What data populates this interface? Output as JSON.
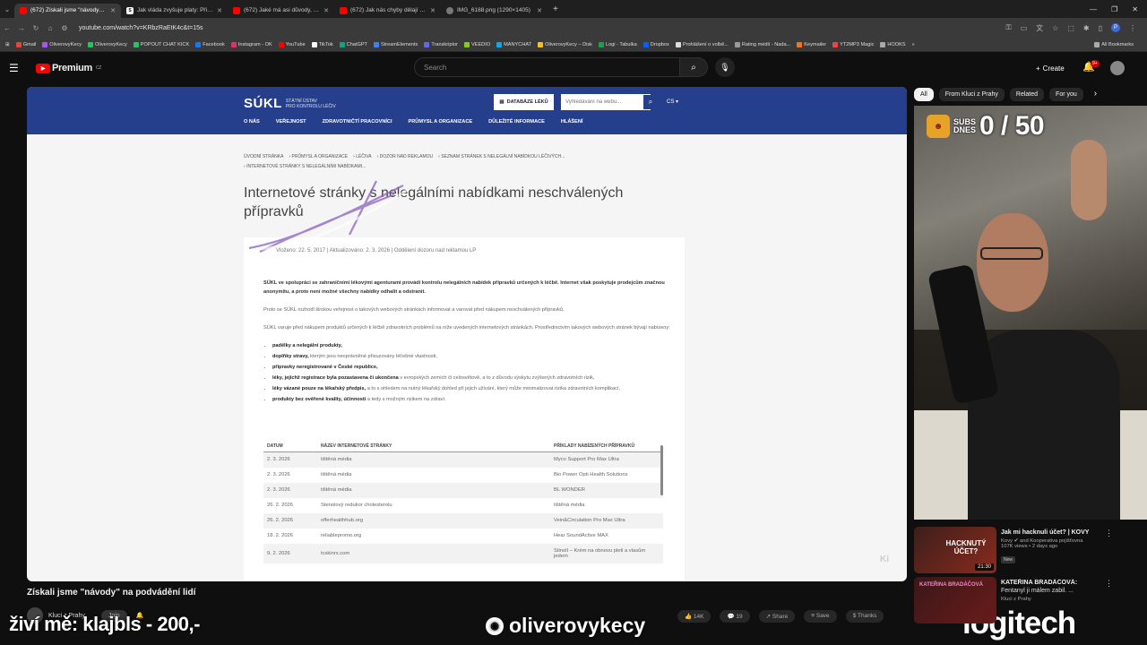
{
  "browser": {
    "tabs": [
      {
        "title": "(672) Získali jsme \"návody\" na pod",
        "active": true,
        "favicon": "youtube"
      },
      {
        "title": "Jak vláda zvyšuje platy: Přidá lé",
        "active": false,
        "favicon": "szu"
      },
      {
        "title": "(672) Jaké má asi důvody, proč",
        "active": false,
        "favicon": "youtube"
      },
      {
        "title": "(672) Jak nás chyby dělají chyt",
        "active": false,
        "favicon": "youtube"
      },
      {
        "title": "IMG_6188.png (1290×1405)",
        "active": false,
        "favicon": "image"
      }
    ],
    "url": "youtube.com/watch?v=KRbzRaEtK4c&t=15s",
    "bookmarks": [
      "Gmail",
      "OliverovyKecy",
      "OliverovyKecy",
      "POPOUT CHAT KICK",
      "Facebook",
      "Instagram - OK",
      "YouTube",
      "TikTok",
      "ChatGPT",
      "StreamElements",
      "Transkriptor",
      "VEEDIO",
      "MANYCHAT",
      "OliverovyKecy – Disk",
      "Logi - Tabulka",
      "Dropbox",
      "Prohlášení o volbě...",
      "Rating médií - Nada...",
      "Keymailer",
      "YT2MP3 Magic",
      "HOOKS"
    ],
    "all_bookmarks": "All Bookmarks",
    "profile_initial": "P"
  },
  "youtube": {
    "logo_text": "Premium",
    "region": "CZ",
    "search_placeholder": "Search",
    "create_label": "Create",
    "notif_count": "9+",
    "video_title": "Získali jsme \"návody\" na podvádění lidí",
    "channel_name": "Kluci z Prahy",
    "join_label": "Join",
    "actions": {
      "likes": "14K",
      "comments": "19",
      "share": "Share",
      "save": "Save",
      "thanks": "Thanks"
    },
    "chips": [
      "All",
      "From Kluci z Prahy",
      "Related",
      "For you"
    ],
    "recommendations": [
      {
        "title": "Jak mi hacknuli účet? | KOVY",
        "channel": "Kovy",
        "channel_extra": "and Kooperativa pojišťovna",
        "views": "107K views • 2 days ago",
        "badge": "New",
        "duration": "21:30",
        "thumb_text": "HACKNUTÝ ÚČET?"
      },
      {
        "title": "KATEŘINA BRADÁČOVÁ:",
        "subtitle": "Fentanyl ji málem zabil. ...",
        "channel": "Kluci z Prahy",
        "thumb_text": "KATEŘINA BRADÁČOVÁ"
      }
    ]
  },
  "sukl": {
    "logo": "SÚKL",
    "logo_sub1": "STÁTNÍ ÚSTAV",
    "logo_sub2": "PRO KONTROLU LÉČIV",
    "db_button": "DATABÁZE LÉKŮ",
    "search_placeholder": "Vyhledávání na webu...",
    "lang": "CS",
    "nav": [
      "O NÁS",
      "VEŘEJNOST",
      "ZDRAVOTNIČTÍ PRACOVNÍCI",
      "PRŮMYSL A ORGANIZACE",
      "DŮLEŽITÉ INFORMACE",
      "HLÁŠENÍ"
    ],
    "breadcrumb": [
      "ÚVODNÍ STRÁNKA",
      "PRŮMYSL A ORGANIZACE",
      "LÉČIVA",
      "DOZOR NAD REKLAMOU",
      "SEZNAM STRÁNEK S NELEGÁLNÍ NABÍDKOU LÉČIVÝCH...",
      "INTERNETOVÉ STRÁNKY S NELEGÁLNÍMI NABÍDKAMI..."
    ],
    "page_title": "Internetové stránky s nelegálními nabídkami neschválených přípravků",
    "meta": "Vloženo: 22. 5. 2017 | Aktualizováno: 2. 3. 2026 | Oddělení dozoru nad reklamou LP",
    "para1": "SÚKL ve spolupráci se zahraničními lékovými agenturami provádí kontrolu nelegálních nabídek přípravků určených k léčbě. Internet však poskytuje prodejcům značnou anonymitu, a proto není možné všechny nabídky odhalit a odstranit.",
    "para2": "Proto se SÚKL rozhodl širokou veřejnost o takových webových stránkách informovat a varovat před nákupem neschválených přípravků.",
    "para3": "SÚKL varuje před nákupem produktů určených k léčbě zdravotních problémů na níže uvedených internetových stránkách. Prostřednictvím takových webových stránek bývají nabízeny:",
    "list": [
      {
        "bold": "padělky a nelegální produkty,",
        "rest": ""
      },
      {
        "bold": "doplňky stravy,",
        "rest": " kterým jsou neoprávněné přisuzovány léčebné vlastnosti,"
      },
      {
        "bold": "přípravky neregistrované v České republice,",
        "rest": ""
      },
      {
        "bold": "léky, jejichž registrace byla pozastavena či ukončena",
        "rest": " v evropských zemích či celosvětově, a to z důvodu výskytu zvýšených zdravotních rizik,"
      },
      {
        "bold": "léky vázané pouze na lékařský předpis,",
        "rest": " a to s ohledem na nutný lékařský dohled při jejich užívání, který může minimalizovat rizika zdravotních komplikací,"
      },
      {
        "bold": "produkty bez ověřené kvality, účinnosti",
        "rest": " a tedy s možným rizikem na zdraví."
      }
    ],
    "table_headers": [
      "DATUM",
      "NÁZEV INTERNETOVÉ STRÁNKY",
      "PŘÍKLADY NABÍZENÝCH PŘÍPRAVKŮ"
    ],
    "table_rows": [
      [
        "2. 3. 2026",
        "tištěná média",
        "Myco Support Pro Max Ultra"
      ],
      [
        "2. 3. 2026",
        "tištěná média",
        "Bio Power Opti Health Solutions"
      ],
      [
        "2. 3. 2026",
        "tištěná média",
        "BL WONDER"
      ],
      [
        "26. 2. 2026",
        "Stenolový redukor cholesterolu",
        "tištěná média"
      ],
      [
        "26. 2. 2026",
        "offerhealthhub.org",
        "Vein&Circulation Pro Max Ultra"
      ],
      [
        "18. 2. 2026",
        "reliablepromo.org",
        "Hear SoundActive MAX"
      ],
      [
        "9. 2. 2026",
        "tcskinrx.com",
        "Stinolí – Krém na obnovu pleti a vlasům jedem"
      ]
    ],
    "watermark": "Ki"
  },
  "stream": {
    "subs_label_1": "SUBS",
    "subs_label_2": "DNES",
    "subs_count": "0 / 50",
    "overlay_left": "živí mě: klajbls - 200,-",
    "overlay_mid": "oliverovykecy",
    "overlay_right": "logitech"
  },
  "colors": {
    "sukl_blue": "#263f8c",
    "yt_red": "#ff0000",
    "dark_bg": "#0f0f0f"
  }
}
